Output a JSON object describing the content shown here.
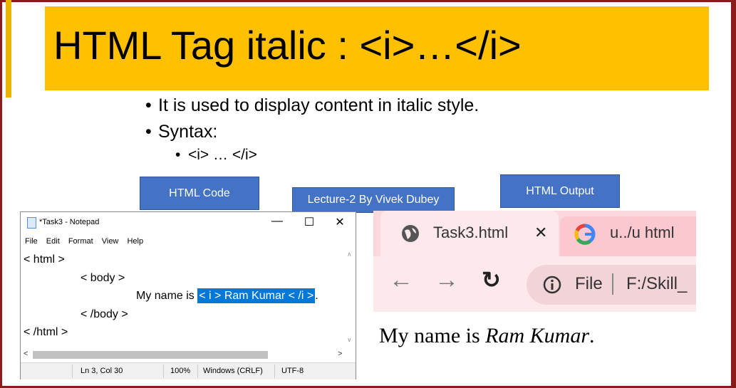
{
  "slide": {
    "title": "HTML Tag italic : <i>…</i>",
    "bullets": [
      "It is used to display content in italic style.",
      "Syntax:"
    ],
    "sub_bullet": "<i> … </i>",
    "labels": {
      "html_code": "HTML Code",
      "lecture": "Lecture-2 By Vivek Dubey",
      "html_output": "HTML Output"
    },
    "colors": {
      "title_bg": "#ffc000",
      "label_bg": "#4472c4",
      "border": "#8b1a1a"
    }
  },
  "notepad": {
    "window_title": "*Task3 - Notepad",
    "menu": [
      "File",
      "Edit",
      "Format",
      "View",
      "Help"
    ],
    "lines": {
      "l1": "< html >",
      "l2": "< body >",
      "l3_prefix": "My name is ",
      "l3_selected": "< i > Ram Kumar < /i >",
      "l3_suffix": ".",
      "l4": "< /body >",
      "l5": "< /html >"
    },
    "status": {
      "position": "Ln 3, Col 30",
      "zoom": "100%",
      "line_ending": "Windows (CRLF)",
      "encoding": "UTF-8"
    },
    "window_buttons": {
      "minimize": "—",
      "maximize": "☐",
      "close": "✕"
    }
  },
  "browser": {
    "tab_active": "Task3.html",
    "tab_close": "✕",
    "tab2": "u../u html",
    "address_scheme": "File",
    "address_path": "F:/Skill_",
    "icons": [
      "globe-icon",
      "google-icon",
      "back-icon",
      "forward-icon",
      "reload-icon",
      "info-icon"
    ]
  },
  "output": {
    "prefix": "My name is ",
    "italic": "Ram Kumar",
    "suffix": "."
  }
}
